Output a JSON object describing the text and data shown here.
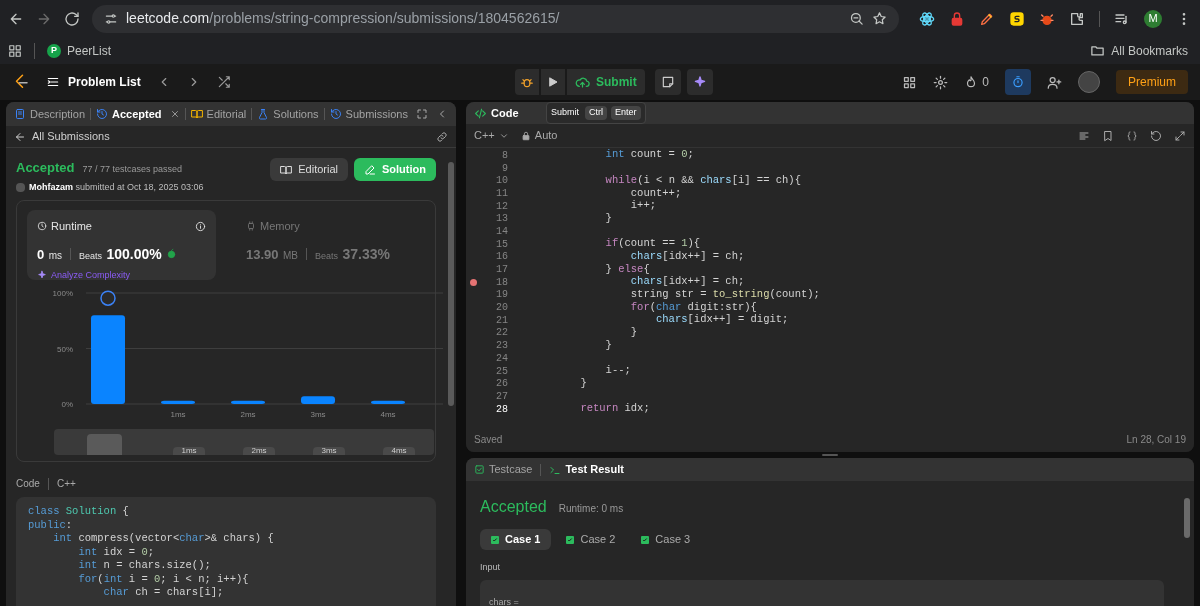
{
  "browser": {
    "url_host": "leetcode.com",
    "url_path": "/problems/string-compression/submissions/1804562615/",
    "profile": "M",
    "bookmarks": [
      {
        "icon_letter": "P",
        "label": "PeerList"
      }
    ],
    "all_bookmarks": "All Bookmarks"
  },
  "nav": {
    "problem_list": "Problem List",
    "submit": "Submit",
    "streak": "0",
    "premium": "Premium"
  },
  "left_tabs": [
    {
      "kind": "description",
      "label": "Description",
      "selected": false
    },
    {
      "kind": "accepted",
      "label": "Accepted",
      "selected": true
    },
    {
      "kind": "editorial",
      "label": "Editorial",
      "selected": false
    },
    {
      "kind": "solutions",
      "label": "Solutions",
      "selected": false
    },
    {
      "kind": "submissions",
      "label": "Submissions",
      "selected": false
    }
  ],
  "back_link": "All Submissions",
  "submission": {
    "status": "Accepted",
    "tests": "77 / 77 testcases passed",
    "user": "Mohfazam",
    "submitted": "submitted at Oct 18, 2025 03:06",
    "editorial_button": "Editorial",
    "solution_button": "Solution"
  },
  "stats": [
    {
      "kind": "runtime",
      "title": "Runtime",
      "value": "0",
      "unit": "ms",
      "beats_label": "Beats",
      "beats": "100.00%",
      "analyze": "Analyze Complexity",
      "selected": true
    },
    {
      "kind": "memory",
      "title": "Memory",
      "value": "13.90",
      "unit": "MB",
      "beats_label": "Beats",
      "beats": "37.33%",
      "selected": false
    }
  ],
  "chart_data": {
    "type": "bar",
    "categories": [
      null,
      "1ms",
      "2ms",
      "3ms",
      "4ms"
    ],
    "series": [
      {
        "color": "#0a84ff",
        "values": [
          80,
          3,
          3,
          7,
          3
        ]
      }
    ],
    "ylim": [
      0,
      100
    ],
    "yticks": [
      {
        "value": 0,
        "label": "0%"
      },
      {
        "value": 50,
        "label": "50%"
      },
      {
        "value": 100,
        "label": "100%"
      }
    ]
  },
  "minimap_labels": [
    "1ms",
    "2ms",
    "3ms",
    "4ms"
  ],
  "code_header": {
    "label": "Code",
    "language": "C++"
  },
  "submitted_code": [
    [
      {
        "text": "class",
        "kind": "type"
      },
      {
        "text": " Solution",
        "kind": "cls"
      },
      " {"
    ],
    [
      {
        "text": "public",
        "kind": "type"
      },
      ":"
    ],
    [
      {
        "text": "    int",
        "kind": "type"
      },
      " compress(vector<",
      {
        "text": "char",
        "kind": "type"
      },
      ">& chars) {"
    ],
    [
      {
        "text": "        int",
        "kind": "type"
      },
      " idx = ",
      {
        "text": "0",
        "kind": "num"
      },
      ";"
    ],
    [
      {
        "text": "        int",
        "kind": "type"
      },
      " n = chars.size();"
    ],
    [
      {
        "text": "        for",
        "kind": "type"
      },
      "(",
      {
        "text": "int",
        "kind": "type"
      },
      " i = ",
      {
        "text": "0",
        "kind": "num"
      },
      "; i < n; i++){"
    ],
    [
      {
        "text": "            char",
        "kind": "type"
      },
      " ch = chars[i];"
    ]
  ],
  "editor": {
    "title": "Code",
    "tooltip": {
      "label": "Submit",
      "keys": [
        "Ctrl",
        "Enter"
      ]
    },
    "language": "C++",
    "mode": "Auto",
    "status": "Saved",
    "cursor": "Ln 28, Col 19",
    "lines": [
      {
        "number": "8",
        "breakpoint": false,
        "current": false,
        "segments": [
          {
            "text": "            int",
            "kind": "type"
          },
          " count = ",
          {
            "text": "0",
            "kind": "num"
          },
          ";"
        ]
      },
      {
        "number": "9",
        "breakpoint": false,
        "current": false
      },
      {
        "number": "10",
        "breakpoint": false,
        "current": false,
        "segments": [
          {
            "text": "            while",
            "kind": "kw"
          },
          "(i < n && ",
          {
            "text": "chars",
            "kind": "var"
          },
          "[i] == ch){"
        ]
      },
      {
        "number": "11",
        "breakpoint": false,
        "current": false,
        "segments": [
          "                count++;"
        ]
      },
      {
        "number": "12",
        "breakpoint": false,
        "current": false,
        "segments": [
          "                i++;"
        ]
      },
      {
        "number": "13",
        "breakpoint": false,
        "current": false,
        "segments": [
          "            }"
        ]
      },
      {
        "number": "14",
        "breakpoint": false,
        "current": false
      },
      {
        "number": "15",
        "breakpoint": false,
        "current": false,
        "segments": [
          {
            "text": "            if",
            "kind": "kw"
          },
          "(count == ",
          {
            "text": "1",
            "kind": "num"
          },
          "){"
        ]
      },
      {
        "number": "16",
        "breakpoint": false,
        "current": false,
        "segments": [
          {
            "text": "                chars",
            "kind": "var"
          },
          "[idx++] = ch;"
        ]
      },
      {
        "number": "17",
        "breakpoint": false,
        "current": false,
        "segments": [
          "            } ",
          {
            "text": "else",
            "kind": "kw"
          },
          "{"
        ]
      },
      {
        "number": "18",
        "breakpoint": true,
        "current": false,
        "segments": [
          {
            "text": "                chars",
            "kind": "var"
          },
          "[idx++] = ch;"
        ]
      },
      {
        "number": "19",
        "breakpoint": false,
        "current": false,
        "segments": [
          "                string str = ",
          {
            "text": "to_string",
            "kind": "fn"
          },
          "(count);"
        ]
      },
      {
        "number": "20",
        "breakpoint": false,
        "current": false,
        "segments": [
          {
            "text": "                for",
            "kind": "kw"
          },
          "(",
          {
            "text": "char",
            "kind": "type"
          },
          " digit:str){"
        ]
      },
      {
        "number": "21",
        "breakpoint": false,
        "current": false,
        "segments": [
          {
            "text": "                    chars",
            "kind": "var"
          },
          "[idx++] = digit;"
        ]
      },
      {
        "number": "22",
        "breakpoint": false,
        "current": false,
        "segments": [
          "                }"
        ]
      },
      {
        "number": "23",
        "breakpoint": false,
        "current": false,
        "segments": [
          "            }"
        ]
      },
      {
        "number": "24",
        "breakpoint": false,
        "current": false
      },
      {
        "number": "25",
        "breakpoint": false,
        "current": false,
        "segments": [
          "            i--;"
        ]
      },
      {
        "number": "26",
        "breakpoint": false,
        "current": false,
        "segments": [
          "        }"
        ]
      },
      {
        "number": "27",
        "breakpoint": false,
        "current": false
      },
      {
        "number": "28",
        "breakpoint": false,
        "current": true,
        "segments": [
          {
            "text": "        return",
            "kind": "kw"
          },
          " idx;"
        ]
      }
    ]
  },
  "tests": {
    "tabs": [
      {
        "kind": "testcase",
        "label": "Testcase",
        "selected": false
      },
      {
        "kind": "result",
        "label": "Test Result",
        "selected": true
      }
    ],
    "status": "Accepted",
    "runtime": "Runtime: 0 ms",
    "cases": [
      {
        "label": "Case 1",
        "selected": true,
        "passed": true
      },
      {
        "label": "Case 2",
        "selected": false,
        "passed": true
      },
      {
        "label": "Case 3",
        "selected": false,
        "passed": true
      }
    ],
    "input_label": "Input",
    "variable": "chars ="
  }
}
